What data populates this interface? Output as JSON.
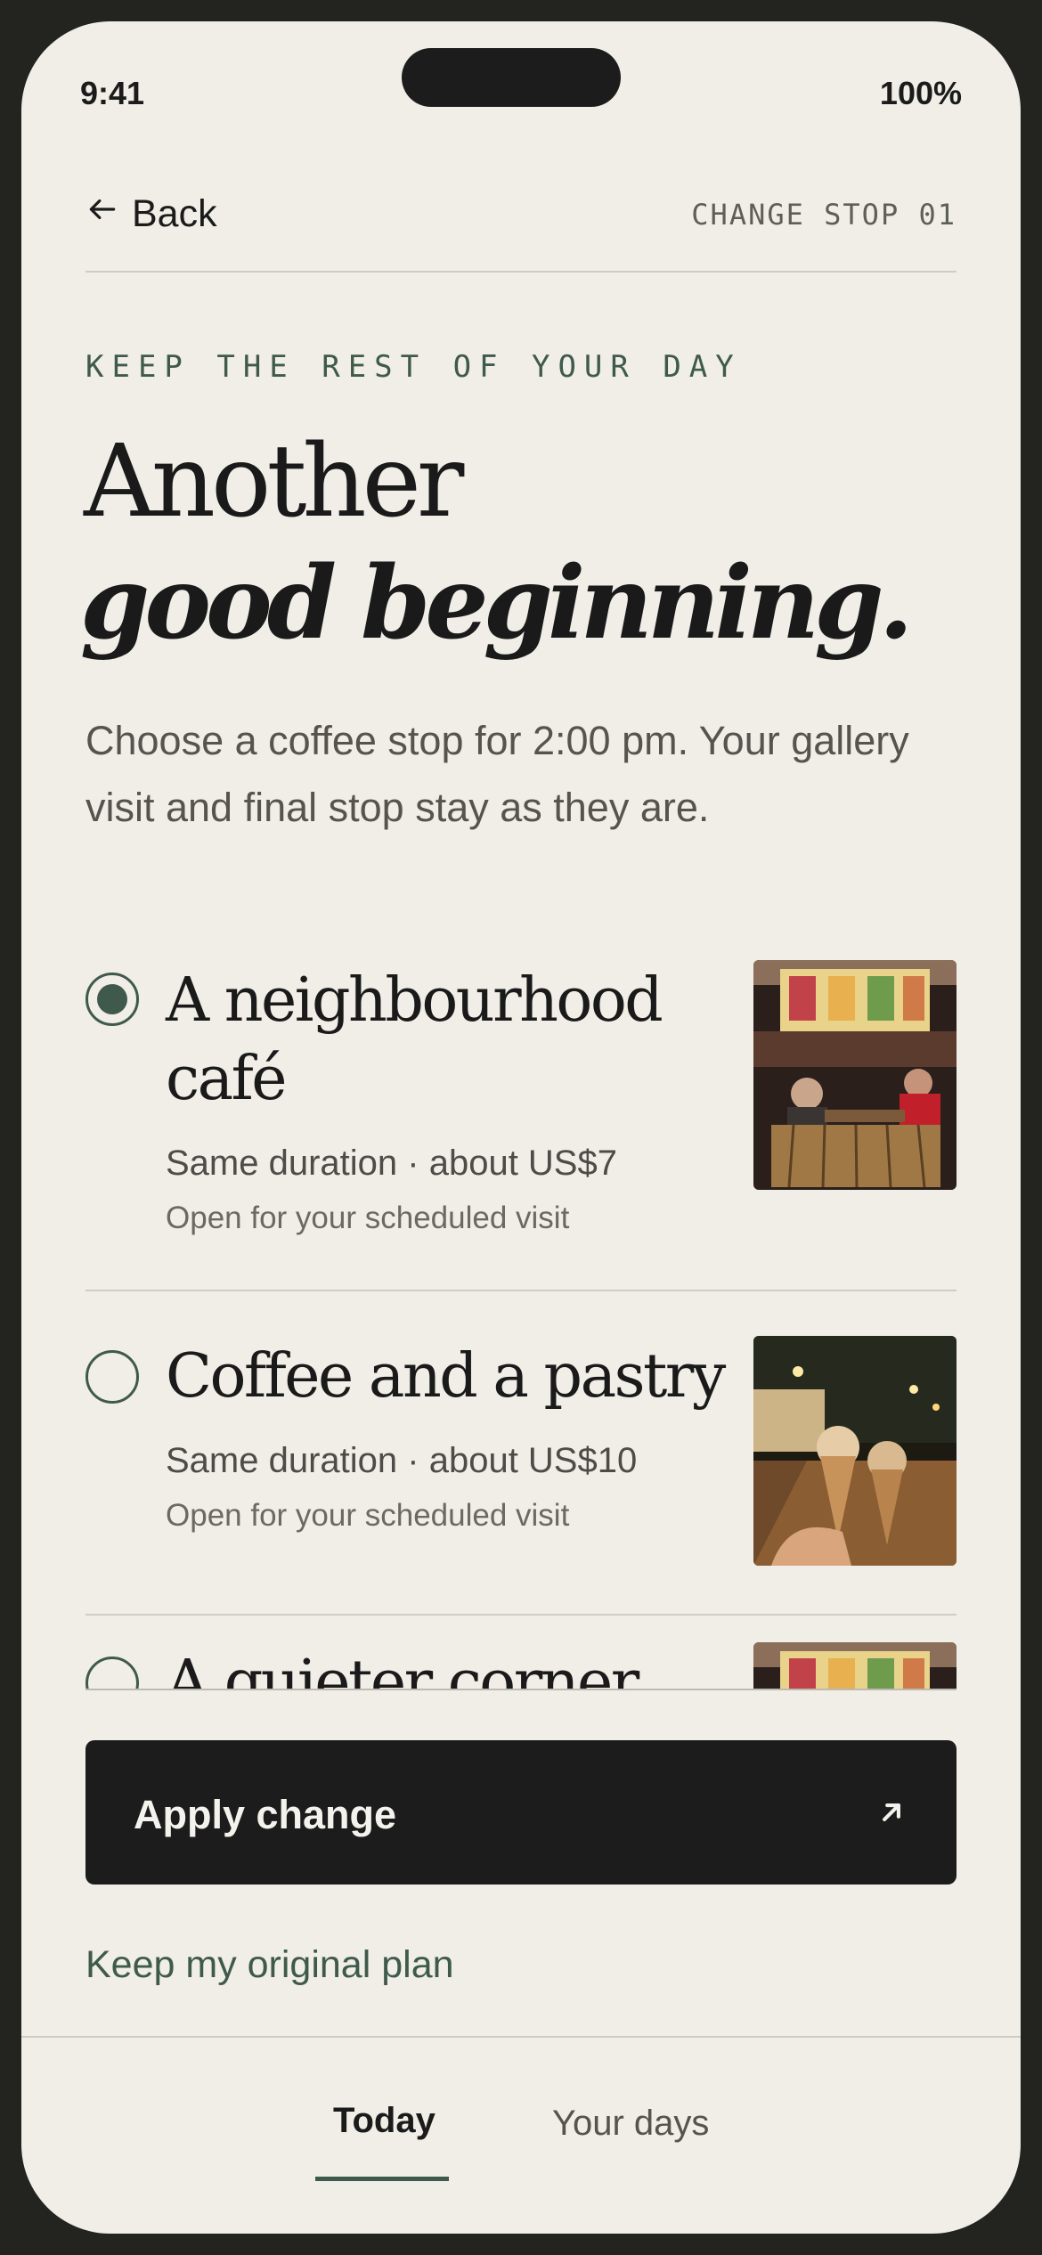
{
  "status_bar": {
    "time": "9:41",
    "battery": "100%"
  },
  "nav": {
    "back_label": "Back",
    "step_label": "CHANGE STOP 01"
  },
  "header": {
    "eyebrow": "KEEP THE REST OF YOUR DAY",
    "title_line1": "Another",
    "title_line2": "good beginning.",
    "intro": "Choose a coffee stop for 2:00 pm. Your gallery visit and final stop stay as they are."
  },
  "options": [
    {
      "title_line1": "A neighbourhood",
      "title_line2": "café",
      "meta": "Same duration · about US$7",
      "sub": "Open for your scheduled visit",
      "selected": true,
      "image": "cafe-terrace-photo"
    },
    {
      "title_line1": "Coffee and a pastry",
      "meta": "Same duration · about US$10",
      "sub": "Open for your scheduled visit",
      "selected": false,
      "image": "ice-cream-cones-street-photo"
    },
    {
      "title_line1": "A quieter corner",
      "selected": false,
      "image": "cafe-terrace-photo"
    }
  ],
  "actions": {
    "apply_label": "Apply change",
    "keep_label": "Keep my original plan"
  },
  "tabs": [
    {
      "label": "Today",
      "active": true
    },
    {
      "label": "Your days",
      "active": false
    }
  ],
  "colors": {
    "accent": "#3f5a4c",
    "background": "#f0eee7",
    "button": "#1c1c1c"
  }
}
